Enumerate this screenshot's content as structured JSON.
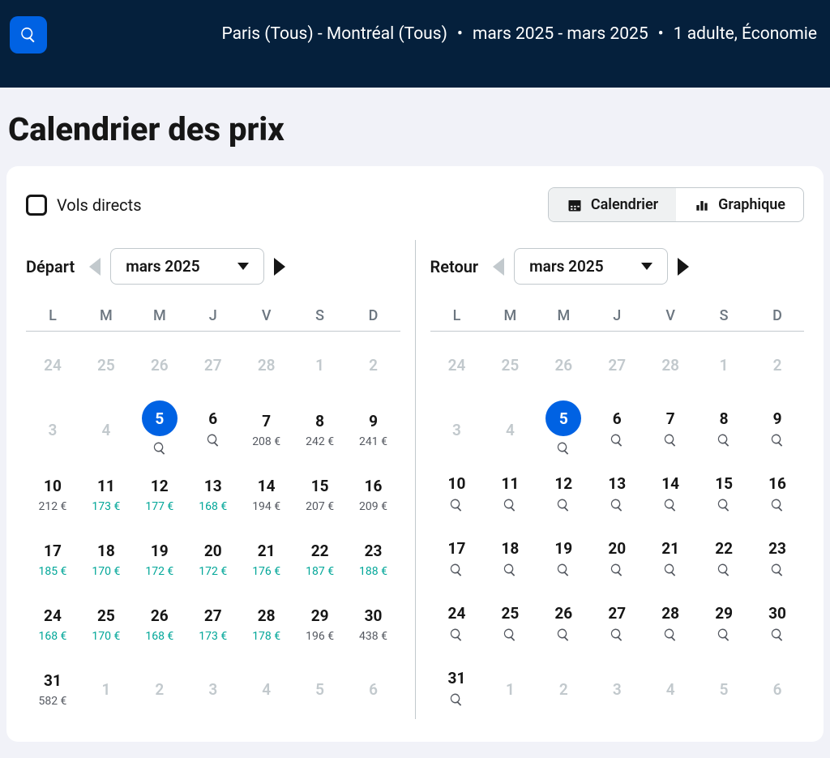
{
  "header": {
    "route": "Paris (Tous) - Montréal (Tous)",
    "dates": "mars 2025 - mars 2025",
    "pax": "1 adulte, Économie"
  },
  "page_title": "Calendrier des prix",
  "direct_flights_label": "Vols directs",
  "view": {
    "calendar": "Calendrier",
    "chart": "Graphique"
  },
  "weekdays": [
    "L",
    "M",
    "M",
    "J",
    "V",
    "S",
    "D"
  ],
  "depart": {
    "label": "Départ",
    "month": "mars 2025",
    "days": [
      {
        "n": 24,
        "inactive": true
      },
      {
        "n": 25,
        "inactive": true
      },
      {
        "n": 26,
        "inactive": true
      },
      {
        "n": 27,
        "inactive": true
      },
      {
        "n": 28,
        "inactive": true
      },
      {
        "n": 1,
        "inactive": true
      },
      {
        "n": 2,
        "inactive": true
      },
      {
        "n": 3,
        "inactive": true
      },
      {
        "n": 4,
        "inactive": true
      },
      {
        "n": 5,
        "selected": true,
        "search": true
      },
      {
        "n": 6,
        "search": true
      },
      {
        "n": 7,
        "price": "208 €"
      },
      {
        "n": 8,
        "price": "242 €"
      },
      {
        "n": 9,
        "price": "241 €"
      },
      {
        "n": 10,
        "price": "212 €"
      },
      {
        "n": 11,
        "price": "173 €",
        "teal": true
      },
      {
        "n": 12,
        "price": "177 €",
        "teal": true
      },
      {
        "n": 13,
        "price": "168 €",
        "teal": true
      },
      {
        "n": 14,
        "price": "194 €"
      },
      {
        "n": 15,
        "price": "207 €"
      },
      {
        "n": 16,
        "price": "209 €"
      },
      {
        "n": 17,
        "price": "185 €",
        "teal": true
      },
      {
        "n": 18,
        "price": "170 €",
        "teal": true
      },
      {
        "n": 19,
        "price": "172 €",
        "teal": true
      },
      {
        "n": 20,
        "price": "172 €",
        "teal": true
      },
      {
        "n": 21,
        "price": "176 €",
        "teal": true
      },
      {
        "n": 22,
        "price": "187 €",
        "teal": true
      },
      {
        "n": 23,
        "price": "188 €",
        "teal": true
      },
      {
        "n": 24,
        "price": "168 €",
        "teal": true
      },
      {
        "n": 25,
        "price": "170 €",
        "teal": true
      },
      {
        "n": 26,
        "price": "168 €",
        "teal": true
      },
      {
        "n": 27,
        "price": "173 €",
        "teal": true
      },
      {
        "n": 28,
        "price": "178 €",
        "teal": true
      },
      {
        "n": 29,
        "price": "196 €"
      },
      {
        "n": 30,
        "price": "438 €"
      },
      {
        "n": 31,
        "price": "582 €"
      },
      {
        "n": 1,
        "inactive": true
      },
      {
        "n": 2,
        "inactive": true
      },
      {
        "n": 3,
        "inactive": true
      },
      {
        "n": 4,
        "inactive": true
      },
      {
        "n": 5,
        "inactive": true
      },
      {
        "n": 6,
        "inactive": true
      }
    ]
  },
  "return": {
    "label": "Retour",
    "month": "mars 2025",
    "days": [
      {
        "n": 24,
        "inactive": true
      },
      {
        "n": 25,
        "inactive": true
      },
      {
        "n": 26,
        "inactive": true
      },
      {
        "n": 27,
        "inactive": true
      },
      {
        "n": 28,
        "inactive": true
      },
      {
        "n": 1,
        "inactive": true
      },
      {
        "n": 2,
        "inactive": true
      },
      {
        "n": 3,
        "inactive": true
      },
      {
        "n": 4,
        "inactive": true
      },
      {
        "n": 5,
        "selected": true,
        "search": true
      },
      {
        "n": 6,
        "search": true
      },
      {
        "n": 7,
        "search": true
      },
      {
        "n": 8,
        "search": true
      },
      {
        "n": 9,
        "search": true
      },
      {
        "n": 10,
        "search": true
      },
      {
        "n": 11,
        "search": true
      },
      {
        "n": 12,
        "search": true
      },
      {
        "n": 13,
        "search": true
      },
      {
        "n": 14,
        "search": true
      },
      {
        "n": 15,
        "search": true
      },
      {
        "n": 16,
        "search": true
      },
      {
        "n": 17,
        "search": true
      },
      {
        "n": 18,
        "search": true
      },
      {
        "n": 19,
        "search": true
      },
      {
        "n": 20,
        "search": true
      },
      {
        "n": 21,
        "search": true
      },
      {
        "n": 22,
        "search": true
      },
      {
        "n": 23,
        "search": true
      },
      {
        "n": 24,
        "search": true
      },
      {
        "n": 25,
        "search": true
      },
      {
        "n": 26,
        "search": true
      },
      {
        "n": 27,
        "search": true
      },
      {
        "n": 28,
        "search": true
      },
      {
        "n": 29,
        "search": true
      },
      {
        "n": 30,
        "search": true
      },
      {
        "n": 31,
        "search": true
      },
      {
        "n": 1,
        "inactive": true
      },
      {
        "n": 2,
        "inactive": true
      },
      {
        "n": 3,
        "inactive": true
      },
      {
        "n": 4,
        "inactive": true
      },
      {
        "n": 5,
        "inactive": true
      },
      {
        "n": 6,
        "inactive": true
      }
    ]
  }
}
